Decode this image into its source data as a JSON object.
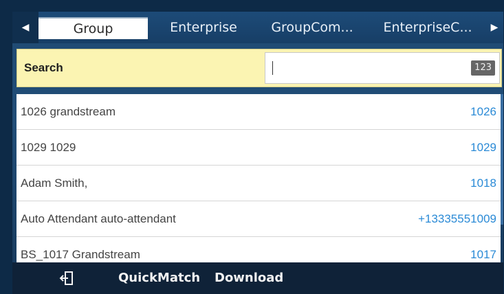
{
  "tabs": [
    {
      "label": "Group",
      "active": true
    },
    {
      "label": "Enterprise",
      "active": false
    },
    {
      "label": "GroupCom...",
      "active": false
    },
    {
      "label": "EnterpriseC...",
      "active": false
    }
  ],
  "nav": {
    "left_icon": "arrow-left-icon",
    "right_icon": "arrow-right-icon"
  },
  "search": {
    "label": "Search",
    "value": "",
    "input_mode": "123"
  },
  "contacts": [
    {
      "name": "1026 grandstream",
      "number": "1026"
    },
    {
      "name": "1029 1029",
      "number": "1029"
    },
    {
      "name": "Adam Smith,",
      "number": "1018"
    },
    {
      "name": "Auto Attendant auto-attendant",
      "number": "+13335551009"
    },
    {
      "name": "BS_1017 Grandstream",
      "number": "1017"
    }
  ],
  "softkeys": {
    "back_icon": "exit-icon",
    "quickmatch": "QuickMatch",
    "download": "Download"
  },
  "colors": {
    "accent": "#2a8ad6",
    "search_bg": "#fbf4b2",
    "bar_bg": "#0f2238",
    "tabbar_bg": "#1d4b78"
  }
}
